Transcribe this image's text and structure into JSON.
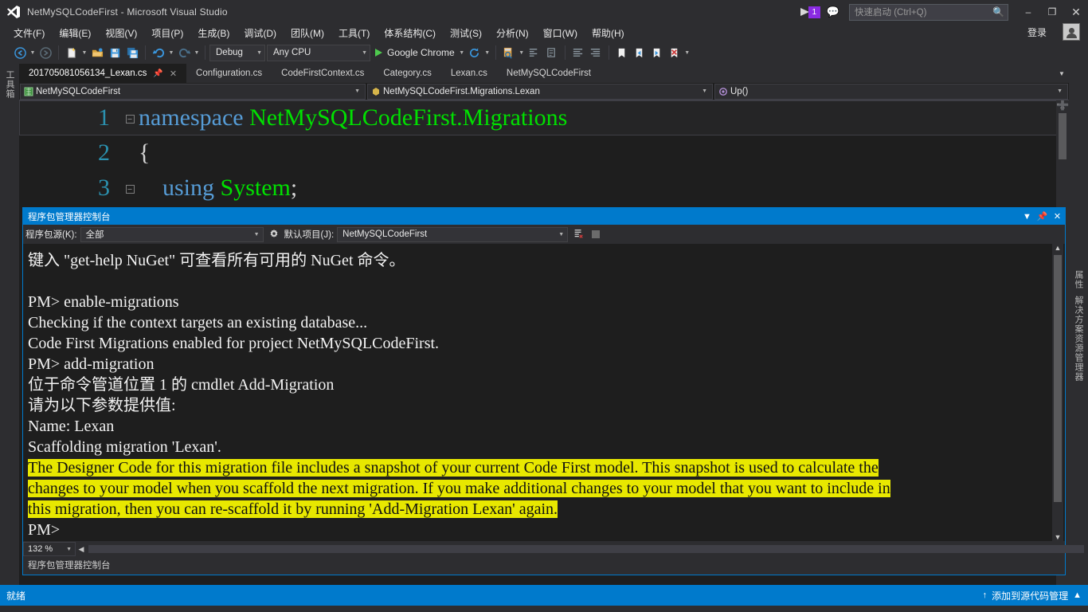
{
  "titlebar": {
    "app_title": "NetMySQLCodeFirst - Microsoft Visual Studio",
    "logo_icon": "visual-studio-logo",
    "feedback_flag_icon": "feedback-flag-icon",
    "notification_count": "1",
    "feedback_icon": "feedback-smiley-icon",
    "minimize_label": "–",
    "maximize_label": "❐",
    "close_label": "✕"
  },
  "quick_launch": {
    "placeholder": "快速启动 (Ctrl+Q)",
    "value": "",
    "search_icon": "search-icon"
  },
  "menubar": {
    "items": [
      {
        "label": "文件(F)"
      },
      {
        "label": "编辑(E)"
      },
      {
        "label": "视图(V)"
      },
      {
        "label": "项目(P)"
      },
      {
        "label": "生成(B)"
      },
      {
        "label": "调试(D)"
      },
      {
        "label": "团队(M)"
      },
      {
        "label": "工具(T)"
      },
      {
        "label": "体系结构(C)"
      },
      {
        "label": "测试(S)"
      },
      {
        "label": "分析(N)"
      },
      {
        "label": "窗口(W)"
      },
      {
        "label": "帮助(H)"
      }
    ],
    "signin_label": "登录",
    "account_icon": "account-avatar-icon"
  },
  "toolbar": {
    "nav_back_icon": "navigate-back-icon",
    "nav_forward_icon": "navigate-forward-icon",
    "new_project_icon": "new-project-icon",
    "open_file_icon": "open-file-icon",
    "save_icon": "save-icon",
    "save_all_icon": "save-all-icon",
    "undo_icon": "undo-icon",
    "redo_icon": "redo-icon",
    "config_value": "Debug",
    "platform_value": "Any CPU",
    "start_label": "Google Chrome",
    "start_icon": "play-icon",
    "refresh_icon": "refresh-icon",
    "find_icon": "find-in-files-icon",
    "indent_icon": "indent-icon",
    "comment_icon": "comment-icon",
    "align_icon": "align-icon",
    "outdent_icon": "outdent-icon",
    "bookmark_icon": "bookmark-icon",
    "prev_bookmark_icon": "previous-bookmark-icon",
    "next_bookmark_icon": "next-bookmark-icon",
    "clear_bookmarks_icon": "clear-bookmarks-icon"
  },
  "left_dock": {
    "toolbox_label": "工具箱"
  },
  "right_dock": {
    "solution_explorer_label": "解决方案资源管理器",
    "properties_label": "属性"
  },
  "doc_tabs": {
    "items": [
      {
        "label": "201705081056134_Lexan.cs",
        "active": true
      },
      {
        "label": "Configuration.cs",
        "active": false
      },
      {
        "label": "CodeFirstContext.cs",
        "active": false
      },
      {
        "label": "Category.cs",
        "active": false
      },
      {
        "label": "Lexan.cs",
        "active": false
      },
      {
        "label": "NetMySQLCodeFirst",
        "active": false
      }
    ],
    "pin_icon": "pin-icon",
    "close_icon": "close-tab-icon",
    "overflow_icon": "chevron-down-icon"
  },
  "navbar": {
    "project": "NetMySQLCodeFirst",
    "project_icon": "project-icon",
    "type": "NetMySQLCodeFirst.Migrations.Lexan",
    "type_icon": "class-icon",
    "member": "Up()",
    "member_icon": "method-icon",
    "caret_icon": "chevron-down-icon"
  },
  "editor": {
    "lines": [
      {
        "number": "1",
        "fold": "minus",
        "current": true,
        "tokens": [
          {
            "text": "namespace ",
            "kind": "kw"
          },
          {
            "text": "NetMySQLCodeFirst.Migrations",
            "kind": "id"
          }
        ]
      },
      {
        "number": "2",
        "fold": "",
        "current": false,
        "tokens": [
          {
            "text": "{",
            "kind": "pl"
          }
        ]
      },
      {
        "number": "3",
        "fold": "minus",
        "current": false,
        "tokens": [
          {
            "text": "    using ",
            "kind": "kw"
          },
          {
            "text": "System",
            "kind": "id"
          },
          {
            "text": ";",
            "kind": "pl"
          }
        ]
      }
    ],
    "colors": {
      "keyword": "#569cd6",
      "identifier": "#00e000",
      "plain": "#d4d4d4",
      "linenumber": "#2b91af"
    }
  },
  "console_panel": {
    "title": "程序包管理器控制台",
    "dropdown_icon": "chevron-down-icon",
    "pin_icon": "pin-icon",
    "close_icon": "close-icon",
    "source_label": "程序包源(K):",
    "source_value": "全部",
    "settings_icon": "gear-icon",
    "project_label": "默认项目(J):",
    "project_value": "NetMySQLCodeFirst",
    "clear_icon": "clear-console-icon",
    "stop_icon": "stop-icon",
    "zoom_value": "132 %",
    "zoom_caret_icon": "chevron-down-icon",
    "status_text": "程序包管理器控制台",
    "output_lines": [
      {
        "text": "键入 \"get-help NuGet\" 可查看所有可用的 NuGet 命令。",
        "highlight": false
      },
      {
        "text": "",
        "highlight": false
      },
      {
        "text": "PM> enable-migrations",
        "highlight": false
      },
      {
        "text": "Checking if the context targets an existing database...",
        "highlight": false
      },
      {
        "text": "Code First Migrations enabled for project NetMySQLCodeFirst.",
        "highlight": false
      },
      {
        "text": "PM> add-migration",
        "highlight": false
      },
      {
        "text": "位于命令管道位置 1 的 cmdlet Add-Migration",
        "highlight": false
      },
      {
        "text": "请为以下参数提供值:",
        "highlight": false
      },
      {
        "text": "Name: Lexan",
        "highlight": false
      },
      {
        "text": "Scaffolding migration 'Lexan'.",
        "highlight": false
      },
      {
        "text": "The Designer Code for this migration file includes a snapshot of your current Code First model. This snapshot is used to calculate the",
        "highlight": true
      },
      {
        "text": "changes to your model when you scaffold the next migration. If you make additional changes to your model that you want to include in",
        "highlight": true
      },
      {
        "text": "this migration, then you can re-scaffold it by running 'Add-Migration Lexan' again.",
        "highlight": true
      },
      {
        "text": "PM>",
        "highlight": false
      }
    ],
    "highlight_color": "#e8e800"
  },
  "statusbar": {
    "ready_text": "就绪",
    "source_control_text": "添加到源代码管理",
    "upload_icon": "upload-arrow-icon",
    "expand_icon": "chevron-up-icon",
    "accent_color": "#007acc"
  }
}
